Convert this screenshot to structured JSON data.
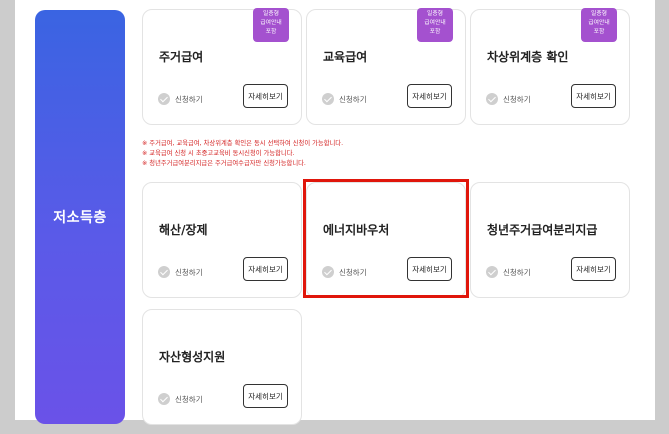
{
  "category": {
    "label": "저소득층"
  },
  "badge_lines": [
    "일층형",
    "급여안내",
    "포함"
  ],
  "apply_label": "신청하기",
  "detail_label": "자세히보기",
  "cards": [
    {
      "title": "주거급여"
    },
    {
      "title": "교육급여"
    },
    {
      "title": "차상위계층 확인"
    },
    {
      "title": "해산/장제"
    },
    {
      "title": "에너지바우처"
    },
    {
      "title": "청년주거급여분리지급"
    },
    {
      "title": "자산형성지원"
    }
  ],
  "notes": [
    "※ 주거급여, 교육급여, 차상위계층 확인은 동시 선택하여 신청이 가능합니다.",
    "※ 교육급여 신청 시 초중고교육비 동시신청이 가능합니다.",
    "※ 청년주거급여분리지급은 주거급여수급자만 신청가능합니다."
  ],
  "colors": {
    "category_gradient_start": "#3a64e2",
    "category_gradient_end": "#6a52e8",
    "badge": "#a451cf",
    "notes": "#d42020",
    "highlight_border": "#e0160b"
  }
}
